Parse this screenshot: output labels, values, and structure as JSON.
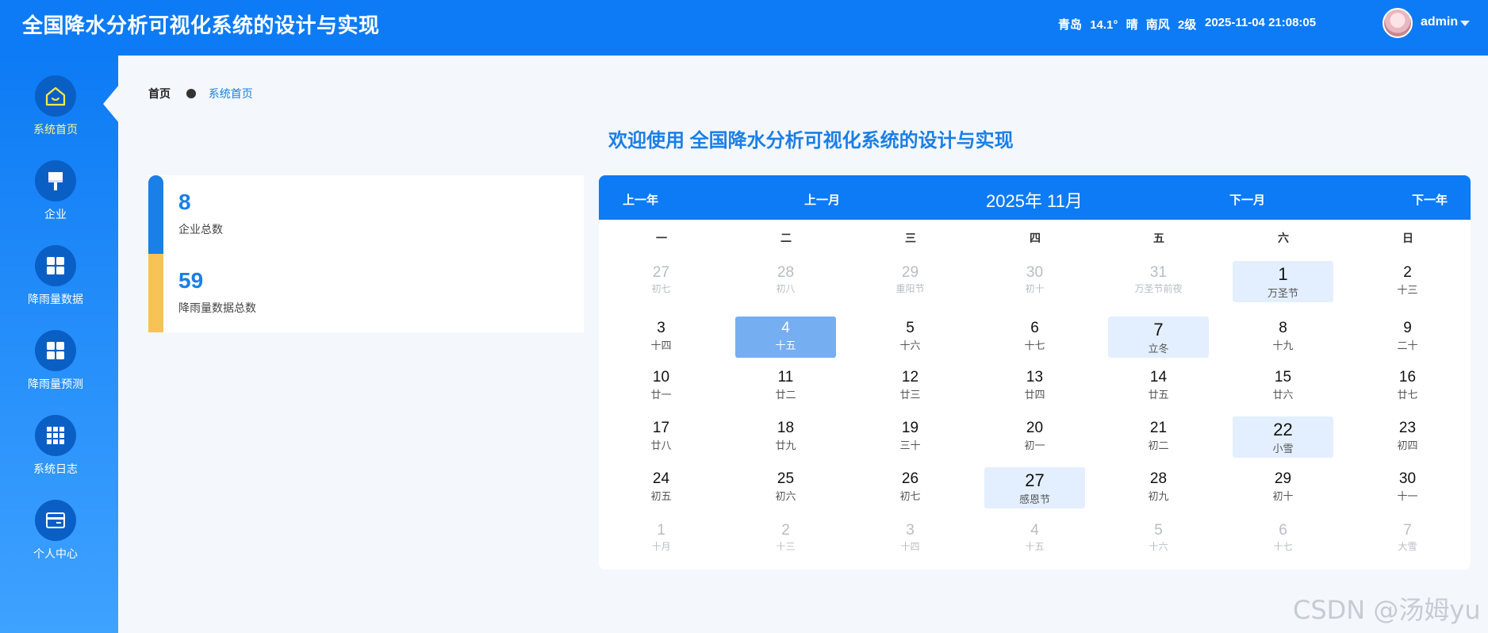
{
  "header": {
    "title": "全国降水分析可视化系统的设计与实现",
    "weather": {
      "city": "青岛",
      "temp": "14.1°",
      "condition": "晴",
      "wind": "南风",
      "level": "2级"
    },
    "datetime": "2025-11-04 21:08:05",
    "username": "admin"
  },
  "sidebar": {
    "items": [
      {
        "label": "系统首页",
        "icon": "home-icon"
      },
      {
        "label": "企业",
        "icon": "brush-icon"
      },
      {
        "label": "降雨量数据",
        "icon": "grid-icon"
      },
      {
        "label": "降雨量预测",
        "icon": "grid-icon"
      },
      {
        "label": "系统日志",
        "icon": "grid9-icon"
      },
      {
        "label": "个人中心",
        "icon": "card-icon"
      }
    ]
  },
  "breadcrumb": {
    "home": "首页",
    "current": "系统首页"
  },
  "welcome": "欢迎使用 全国降水分析可视化系统的设计与实现",
  "stats": [
    {
      "value": "8",
      "label": "企业总数"
    },
    {
      "value": "59",
      "label": "降雨量数据总数"
    }
  ],
  "calendar": {
    "prev_year": "上一年",
    "prev_month": "上一月",
    "title": "2025年 11月",
    "next_month": "下一月",
    "next_year": "下一年",
    "weekdays": [
      "一",
      "二",
      "三",
      "四",
      "五",
      "六",
      "日"
    ],
    "weeks": [
      [
        {
          "d": "27",
          "s": "初七",
          "m": true
        },
        {
          "d": "28",
          "s": "初八",
          "m": true
        },
        {
          "d": "29",
          "s": "重阳节",
          "m": true
        },
        {
          "d": "30",
          "s": "初十",
          "m": true
        },
        {
          "d": "31",
          "s": "万圣节前夜",
          "m": true
        },
        {
          "d": "1",
          "s": "万圣节",
          "h": true
        },
        {
          "d": "2",
          "s": "十三"
        }
      ],
      [
        {
          "d": "3",
          "s": "十四"
        },
        {
          "d": "4",
          "s": "十五",
          "sel": true
        },
        {
          "d": "5",
          "s": "十六"
        },
        {
          "d": "6",
          "s": "十七"
        },
        {
          "d": "7",
          "s": "立冬",
          "h": true
        },
        {
          "d": "8",
          "s": "十九"
        },
        {
          "d": "9",
          "s": "二十"
        }
      ],
      [
        {
          "d": "10",
          "s": "廿一"
        },
        {
          "d": "11",
          "s": "廿二"
        },
        {
          "d": "12",
          "s": "廿三"
        },
        {
          "d": "13",
          "s": "廿四"
        },
        {
          "d": "14",
          "s": "廿五"
        },
        {
          "d": "15",
          "s": "廿六"
        },
        {
          "d": "16",
          "s": "廿七"
        }
      ],
      [
        {
          "d": "17",
          "s": "廿八"
        },
        {
          "d": "18",
          "s": "廿九"
        },
        {
          "d": "19",
          "s": "三十"
        },
        {
          "d": "20",
          "s": "初一"
        },
        {
          "d": "21",
          "s": "初二"
        },
        {
          "d": "22",
          "s": "小雪",
          "h": true
        },
        {
          "d": "23",
          "s": "初四"
        }
      ],
      [
        {
          "d": "24",
          "s": "初五"
        },
        {
          "d": "25",
          "s": "初六"
        },
        {
          "d": "26",
          "s": "初七"
        },
        {
          "d": "27",
          "s": "感恩节",
          "h": true
        },
        {
          "d": "28",
          "s": "初九"
        },
        {
          "d": "29",
          "s": "初十"
        },
        {
          "d": "30",
          "s": "十一"
        }
      ],
      [
        {
          "d": "1",
          "s": "十月",
          "m": true
        },
        {
          "d": "2",
          "s": "十三",
          "m": true
        },
        {
          "d": "3",
          "s": "十四",
          "m": true
        },
        {
          "d": "4",
          "s": "十五",
          "m": true
        },
        {
          "d": "5",
          "s": "十六",
          "m": true
        },
        {
          "d": "6",
          "s": "十七",
          "m": true
        },
        {
          "d": "7",
          "s": "大雪",
          "m": true
        }
      ]
    ]
  },
  "watermark": "CSDN @汤姆yu",
  "colors": {
    "primary": "#0d7bf5",
    "accent_yellow": "#f7c356",
    "holiday_bg": "#e3efff",
    "selected_bg": "#76aef2"
  }
}
